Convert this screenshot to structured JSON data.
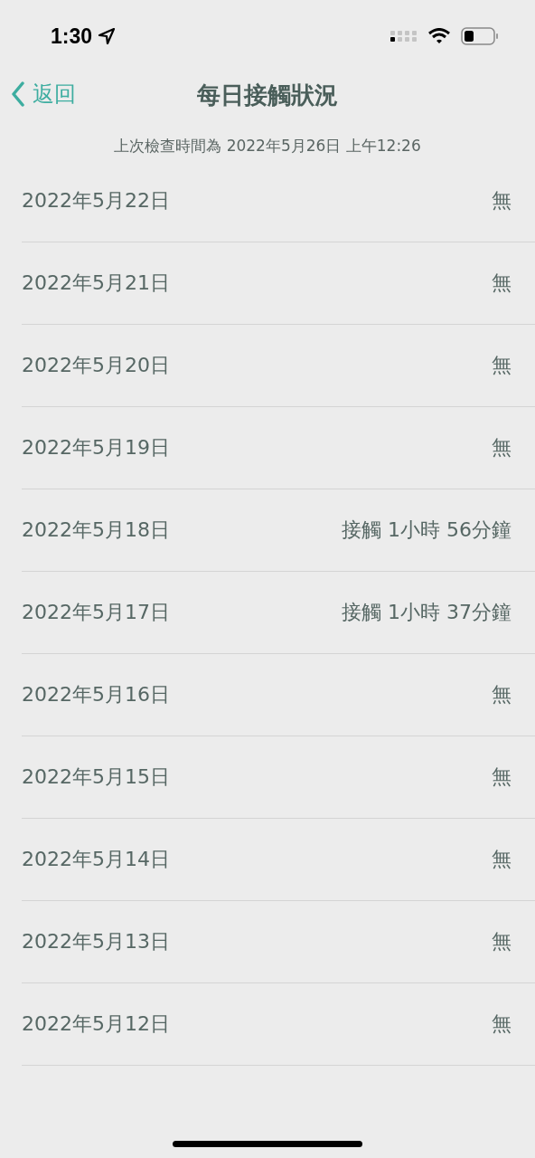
{
  "status_bar": {
    "time": "1:30"
  },
  "nav": {
    "back": "返回",
    "title": "每日接觸狀況"
  },
  "last_checked": "上次檢查時間為 2022年5月26日 上午12:26",
  "days": [
    {
      "date": "2022年5月22日",
      "status": "無"
    },
    {
      "date": "2022年5月21日",
      "status": "無"
    },
    {
      "date": "2022年5月20日",
      "status": "無"
    },
    {
      "date": "2022年5月19日",
      "status": "無"
    },
    {
      "date": "2022年5月18日",
      "status": "接觸 1小時 56分鐘"
    },
    {
      "date": "2022年5月17日",
      "status": "接觸 1小時 37分鐘"
    },
    {
      "date": "2022年5月16日",
      "status": "無"
    },
    {
      "date": "2022年5月15日",
      "status": "無"
    },
    {
      "date": "2022年5月14日",
      "status": "無"
    },
    {
      "date": "2022年5月13日",
      "status": "無"
    },
    {
      "date": "2022年5月12日",
      "status": "無"
    }
  ]
}
